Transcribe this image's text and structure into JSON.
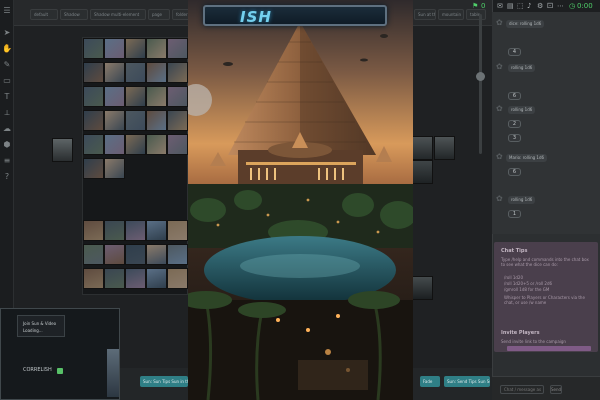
{
  "topbar": {
    "menus": [
      "default",
      "Shadow",
      "Shadow multi-element",
      "page",
      "folder item",
      "Sun at the",
      "mountain",
      "table"
    ]
  },
  "banner": {
    "text": "ISH"
  },
  "right_panel": {
    "counter_left": "0",
    "counter_right": "0:00",
    "rows": [
      {
        "label": "dice: rolling 1d6",
        "value": "4"
      },
      {
        "label": "rolling 1d6",
        "value": "6"
      },
      {
        "label": "rolling 1d6",
        "value": "2"
      },
      {
        "label": "rolling 1d6",
        "value": "3"
      },
      {
        "label": "Mario: rolling 1d6",
        "value": "6"
      },
      {
        "label": "rolling 1d6",
        "value": "1"
      }
    ]
  },
  "tips": {
    "title": "Chat Tips",
    "body": "Type /help and commands into the chat box to see what the dice can do:",
    "items": [
      "/roll 1d20",
      "/roll 1d20+5 or /roll 2d6",
      "/gmroll 1d8 for the GM",
      "Whisper to Players or Characters via the chat, or use /w name"
    ],
    "invite_title": "Invite Players",
    "invite_text": "Send invite link to the campaign"
  },
  "bottom_right": {
    "field": "Chat / message as",
    "button": "Send"
  },
  "bottom_chips": [
    {
      "label": "Shadow multi-element",
      "color": "#b1343d"
    },
    {
      "label": "Sun: Send 1d  Sun in the mountains",
      "color": "#a63a45"
    },
    {
      "label": "Sun: Sun Tips Sun in the mountains",
      "color": "#2f7f86"
    },
    {
      "label": "Fade",
      "color": "#2f7f86"
    },
    {
      "label": "Sun: Send Tips Sun Sun",
      "color": "#2f7f86"
    }
  ],
  "cam": {
    "line1": "Join Sun & Video",
    "line2": "Loading...",
    "name": "CORRELISH"
  },
  "colors": {
    "accent_teal": "#2f7f86",
    "accent_red": "#b1343d",
    "counter_green": "#4fd06a",
    "banner_text": "#74d0ee"
  }
}
